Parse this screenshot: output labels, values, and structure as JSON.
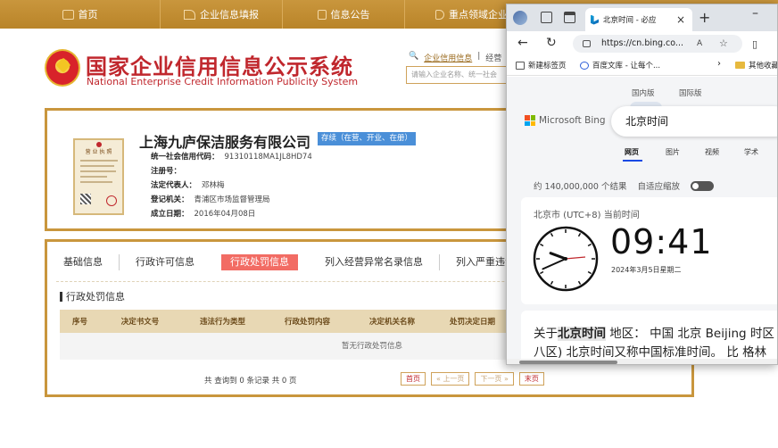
{
  "topnav": {
    "items": [
      {
        "label": "首页",
        "icon": "monitor-icon"
      },
      {
        "label": "企业信息填报",
        "icon": "edit-icon"
      },
      {
        "label": "信息公告",
        "icon": "document-icon"
      },
      {
        "label": "重点领域企业",
        "icon": "speaker-icon"
      }
    ]
  },
  "header": {
    "title": "国家企业信用信息公示系统",
    "subtitle": "National Enterprise Credit Information Publicity System",
    "search_link_1": "企业信用信息",
    "search_link_2": "经营",
    "search_placeholder": "请输入企业名称、统一社会"
  },
  "company": {
    "name": "上海九庐保洁服务有限公司",
    "status": "存续（在营、开业、在册）",
    "license_title": "营 业 执 照",
    "fields": [
      {
        "key": "统一社会信用代码：",
        "value": "91310118MA1JL8HD74"
      },
      {
        "key": "注册号：",
        "value": ""
      },
      {
        "key": "法定代表人：",
        "value": "邓林梅"
      },
      {
        "key": "登记机关：",
        "value": "青浦区市场监督管理局"
      },
      {
        "key": "成立日期：",
        "value": "2016年04月08日"
      }
    ]
  },
  "tabs": [
    "基础信息",
    "行政许可信息",
    "行政处罚信息",
    "列入经营异常名录信息",
    "列入严重违法失信"
  ],
  "active_tab": "行政处罚信息",
  "penalty": {
    "section_title": "行政处罚信息",
    "columns": [
      "序号",
      "决定书文号",
      "违法行为类型",
      "行政处罚内容",
      "决定机关名称",
      "处罚决定日期"
    ],
    "empty_text": "暂无行政处罚信息",
    "pager_info": "共 查询到 0 条记录 共 0 页",
    "pager": [
      "首页",
      "« 上一页",
      "下一页 »",
      "末页"
    ]
  },
  "browser": {
    "tab_title": "北京时间 - 必应",
    "url": "https://cn.bing.co...",
    "favorites": [
      "新建标签页",
      "百度文库 - 让每个...",
      "其他收藏"
    ],
    "scope_on": "国内版",
    "scope_off": "国际版",
    "brand": "Microsoft Bing",
    "query": "北京时间",
    "verticals": [
      "网页",
      "图片",
      "视频",
      "学术"
    ],
    "results_count": "约 140,000,000 个结果",
    "adaptive_zoom": "自适应缩放",
    "clock_label": "北京市 (UTC+8) 当前时间",
    "clock_time": "09:41",
    "clock_date": "2024年3月5日星期二",
    "clock_hour": 9,
    "clock_minute": 41,
    "snippet_pre": "关于",
    "snippet_bold": "北京时间",
    "snippet_post": " 地区： 中国 北京 Beijing 时区",
    "snippet_line2": "八区) 北京时间又称中国标准时间。 比 格林"
  }
}
